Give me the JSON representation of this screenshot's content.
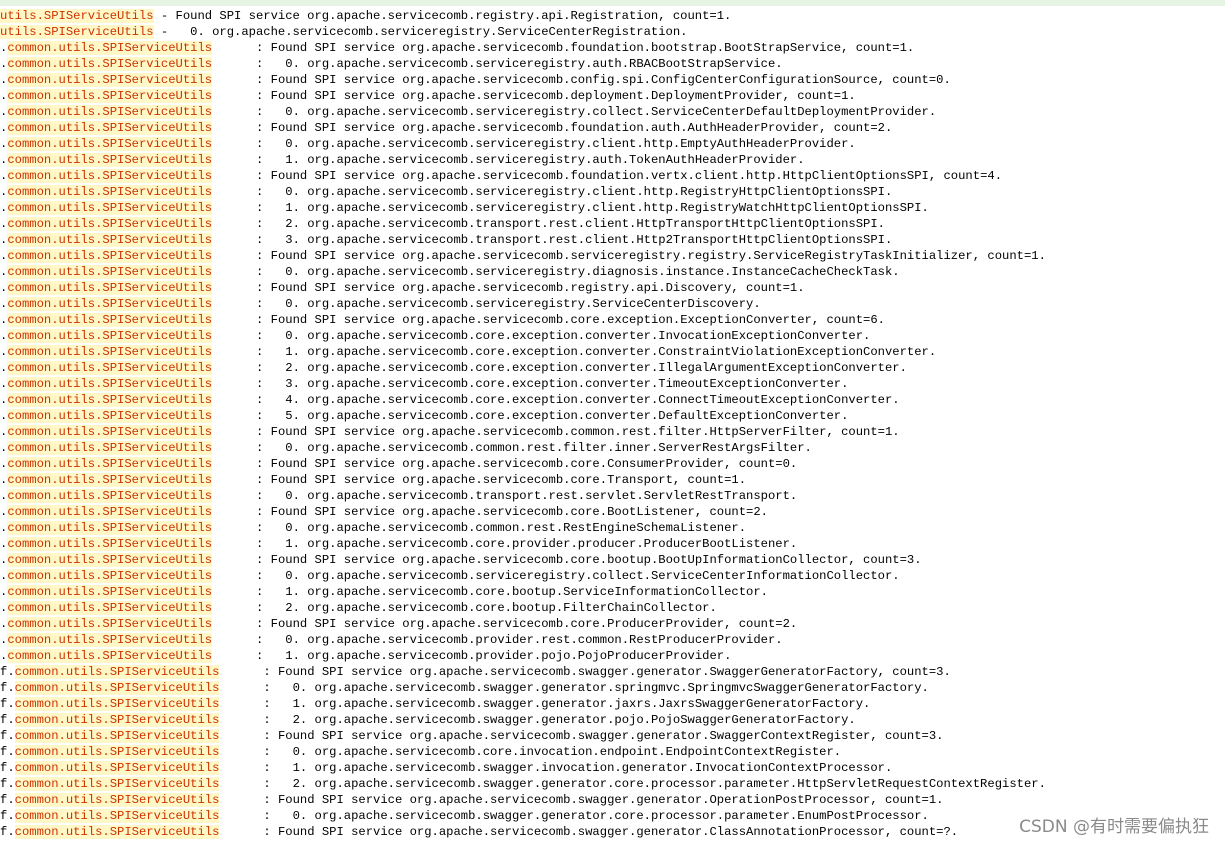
{
  "watermark": "CSDN @有时需要偏执狂",
  "lines": [
    {
      "pre": "",
      "hl": "utils.SPIServiceUtils",
      "text": " - Found SPI service org.apache.servicecomb.registry.api.Registration, count=1."
    },
    {
      "pre": "",
      "hl": "utils.SPIServiceUtils",
      "text": " -   0. org.apache.servicecomb.serviceregistry.ServiceCenterRegistration."
    },
    {
      "pre": ".",
      "hl": "common.utils.SPIServiceUtils",
      "text": "      : Found SPI service org.apache.servicecomb.foundation.bootstrap.BootStrapService, count=1."
    },
    {
      "pre": ".",
      "hl": "common.utils.SPIServiceUtils",
      "text": "      :   0. org.apache.servicecomb.serviceregistry.auth.RBACBootStrapService."
    },
    {
      "pre": ".",
      "hl": "common.utils.SPIServiceUtils",
      "text": "      : Found SPI service org.apache.servicecomb.config.spi.ConfigCenterConfigurationSource, count=0."
    },
    {
      "pre": ".",
      "hl": "common.utils.SPIServiceUtils",
      "text": "      : Found SPI service org.apache.servicecomb.deployment.DeploymentProvider, count=1."
    },
    {
      "pre": ".",
      "hl": "common.utils.SPIServiceUtils",
      "text": "      :   0. org.apache.servicecomb.serviceregistry.collect.ServiceCenterDefaultDeploymentProvider."
    },
    {
      "pre": ".",
      "hl": "common.utils.SPIServiceUtils",
      "text": "      : Found SPI service org.apache.servicecomb.foundation.auth.AuthHeaderProvider, count=2."
    },
    {
      "pre": ".",
      "hl": "common.utils.SPIServiceUtils",
      "text": "      :   0. org.apache.servicecomb.serviceregistry.client.http.EmptyAuthHeaderProvider."
    },
    {
      "pre": ".",
      "hl": "common.utils.SPIServiceUtils",
      "text": "      :   1. org.apache.servicecomb.serviceregistry.auth.TokenAuthHeaderProvider."
    },
    {
      "pre": ".",
      "hl": "common.utils.SPIServiceUtils",
      "text": "      : Found SPI service org.apache.servicecomb.foundation.vertx.client.http.HttpClientOptionsSPI, count=4."
    },
    {
      "pre": ".",
      "hl": "common.utils.SPIServiceUtils",
      "text": "      :   0. org.apache.servicecomb.serviceregistry.client.http.RegistryHttpClientOptionsSPI."
    },
    {
      "pre": ".",
      "hl": "common.utils.SPIServiceUtils",
      "text": "      :   1. org.apache.servicecomb.serviceregistry.client.http.RegistryWatchHttpClientOptionsSPI."
    },
    {
      "pre": ".",
      "hl": "common.utils.SPIServiceUtils",
      "text": "      :   2. org.apache.servicecomb.transport.rest.client.HttpTransportHttpClientOptionsSPI."
    },
    {
      "pre": ".",
      "hl": "common.utils.SPIServiceUtils",
      "text": "      :   3. org.apache.servicecomb.transport.rest.client.Http2TransportHttpClientOptionsSPI."
    },
    {
      "pre": ".",
      "hl": "common.utils.SPIServiceUtils",
      "text": "      : Found SPI service org.apache.servicecomb.serviceregistry.registry.ServiceRegistryTaskInitializer, count=1."
    },
    {
      "pre": ".",
      "hl": "common.utils.SPIServiceUtils",
      "text": "      :   0. org.apache.servicecomb.serviceregistry.diagnosis.instance.InstanceCacheCheckTask."
    },
    {
      "pre": ".",
      "hl": "common.utils.SPIServiceUtils",
      "text": "      : Found SPI service org.apache.servicecomb.registry.api.Discovery, count=1."
    },
    {
      "pre": ".",
      "hl": "common.utils.SPIServiceUtils",
      "text": "      :   0. org.apache.servicecomb.serviceregistry.ServiceCenterDiscovery."
    },
    {
      "pre": ".",
      "hl": "common.utils.SPIServiceUtils",
      "text": "      : Found SPI service org.apache.servicecomb.core.exception.ExceptionConverter, count=6."
    },
    {
      "pre": ".",
      "hl": "common.utils.SPIServiceUtils",
      "text": "      :   0. org.apache.servicecomb.core.exception.converter.InvocationExceptionConverter."
    },
    {
      "pre": ".",
      "hl": "common.utils.SPIServiceUtils",
      "text": "      :   1. org.apache.servicecomb.core.exception.converter.ConstraintViolationExceptionConverter."
    },
    {
      "pre": ".",
      "hl": "common.utils.SPIServiceUtils",
      "text": "      :   2. org.apache.servicecomb.core.exception.converter.IllegalArgumentExceptionConverter."
    },
    {
      "pre": ".",
      "hl": "common.utils.SPIServiceUtils",
      "text": "      :   3. org.apache.servicecomb.core.exception.converter.TimeoutExceptionConverter."
    },
    {
      "pre": ".",
      "hl": "common.utils.SPIServiceUtils",
      "text": "      :   4. org.apache.servicecomb.core.exception.converter.ConnectTimeoutExceptionConverter."
    },
    {
      "pre": ".",
      "hl": "common.utils.SPIServiceUtils",
      "text": "      :   5. org.apache.servicecomb.core.exception.converter.DefaultExceptionConverter."
    },
    {
      "pre": ".",
      "hl": "common.utils.SPIServiceUtils",
      "text": "      : Found SPI service org.apache.servicecomb.common.rest.filter.HttpServerFilter, count=1."
    },
    {
      "pre": ".",
      "hl": "common.utils.SPIServiceUtils",
      "text": "      :   0. org.apache.servicecomb.common.rest.filter.inner.ServerRestArgsFilter."
    },
    {
      "pre": ".",
      "hl": "common.utils.SPIServiceUtils",
      "text": "      : Found SPI service org.apache.servicecomb.core.ConsumerProvider, count=0."
    },
    {
      "pre": ".",
      "hl": "common.utils.SPIServiceUtils",
      "text": "      : Found SPI service org.apache.servicecomb.core.Transport, count=1."
    },
    {
      "pre": ".",
      "hl": "common.utils.SPIServiceUtils",
      "text": "      :   0. org.apache.servicecomb.transport.rest.servlet.ServletRestTransport."
    },
    {
      "pre": ".",
      "hl": "common.utils.SPIServiceUtils",
      "text": "      : Found SPI service org.apache.servicecomb.core.BootListener, count=2."
    },
    {
      "pre": ".",
      "hl": "common.utils.SPIServiceUtils",
      "text": "      :   0. org.apache.servicecomb.common.rest.RestEngineSchemaListener."
    },
    {
      "pre": ".",
      "hl": "common.utils.SPIServiceUtils",
      "text": "      :   1. org.apache.servicecomb.core.provider.producer.ProducerBootListener."
    },
    {
      "pre": ".",
      "hl": "common.utils.SPIServiceUtils",
      "text": "      : Found SPI service org.apache.servicecomb.core.bootup.BootUpInformationCollector, count=3."
    },
    {
      "pre": ".",
      "hl": "common.utils.SPIServiceUtils",
      "text": "      :   0. org.apache.servicecomb.serviceregistry.collect.ServiceCenterInformationCollector."
    },
    {
      "pre": ".",
      "hl": "common.utils.SPIServiceUtils",
      "text": "      :   1. org.apache.servicecomb.core.bootup.ServiceInformationCollector."
    },
    {
      "pre": ".",
      "hl": "common.utils.SPIServiceUtils",
      "text": "      :   2. org.apache.servicecomb.core.bootup.FilterChainCollector."
    },
    {
      "pre": ".",
      "hl": "common.utils.SPIServiceUtils",
      "text": "      : Found SPI service org.apache.servicecomb.core.ProducerProvider, count=2."
    },
    {
      "pre": ".",
      "hl": "common.utils.SPIServiceUtils",
      "text": "      :   0. org.apache.servicecomb.provider.rest.common.RestProducerProvider."
    },
    {
      "pre": ".",
      "hl": "common.utils.SPIServiceUtils",
      "text": "      :   1. org.apache.servicecomb.provider.pojo.PojoProducerProvider."
    },
    {
      "pre": "f.",
      "hl": "common.utils.SPIServiceUtils",
      "text": "      : Found SPI service org.apache.servicecomb.swagger.generator.SwaggerGeneratorFactory, count=3."
    },
    {
      "pre": "f.",
      "hl": "common.utils.SPIServiceUtils",
      "text": "      :   0. org.apache.servicecomb.swagger.generator.springmvc.SpringmvcSwaggerGeneratorFactory."
    },
    {
      "pre": "f.",
      "hl": "common.utils.SPIServiceUtils",
      "text": "      :   1. org.apache.servicecomb.swagger.generator.jaxrs.JaxrsSwaggerGeneratorFactory."
    },
    {
      "pre": "f.",
      "hl": "common.utils.SPIServiceUtils",
      "text": "      :   2. org.apache.servicecomb.swagger.generator.pojo.PojoSwaggerGeneratorFactory."
    },
    {
      "pre": "f.",
      "hl": "common.utils.SPIServiceUtils",
      "text": "      : Found SPI service org.apache.servicecomb.swagger.generator.SwaggerContextRegister, count=3."
    },
    {
      "pre": "f.",
      "hl": "common.utils.SPIServiceUtils",
      "text": "      :   0. org.apache.servicecomb.core.invocation.endpoint.EndpointContextRegister."
    },
    {
      "pre": "f.",
      "hl": "common.utils.SPIServiceUtils",
      "text": "      :   1. org.apache.servicecomb.swagger.invocation.generator.InvocationContextProcessor."
    },
    {
      "pre": "f.",
      "hl": "common.utils.SPIServiceUtils",
      "text": "      :   2. org.apache.servicecomb.swagger.generator.core.processor.parameter.HttpServletRequestContextRegister."
    },
    {
      "pre": "f.",
      "hl": "common.utils.SPIServiceUtils",
      "text": "      : Found SPI service org.apache.servicecomb.swagger.generator.OperationPostProcessor, count=1."
    },
    {
      "pre": "f.",
      "hl": "common.utils.SPIServiceUtils",
      "text": "      :   0. org.apache.servicecomb.swagger.generator.core.processor.parameter.EnumPostProcessor."
    },
    {
      "pre": "f.",
      "hl": "common.utils.SPIServiceUtils",
      "text": "      : Found SPI service org.apache.servicecomb.swagger.generator.ClassAnnotationProcessor, count=?."
    }
  ]
}
